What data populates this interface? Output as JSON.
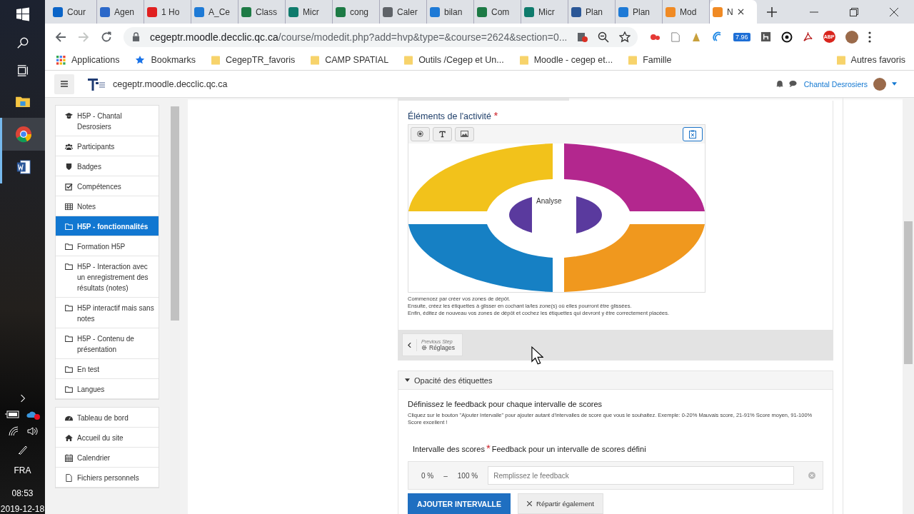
{
  "taskbar": {
    "apps": [
      {
        "kind": "explorer",
        "selected": false,
        "running": false
      },
      {
        "kind": "chrome",
        "selected": true,
        "running": true
      },
      {
        "kind": "word",
        "selected": false,
        "running": true
      }
    ],
    "language": "FRA",
    "time": "08:53",
    "date": "2019-12-18"
  },
  "browser": {
    "tabs": [
      {
        "kind": "outlook",
        "title": "Cour",
        "selected": false
      },
      {
        "kind": "doc",
        "title": "Agen",
        "selected": false
      },
      {
        "kind": "youtube",
        "title": "1 Ho",
        "selected": false
      },
      {
        "kind": "onedrive",
        "title": "A_Ce",
        "selected": false
      },
      {
        "kind": "excel",
        "title": "Class",
        "selected": false
      },
      {
        "kind": "forms",
        "title": "Micr",
        "selected": false
      },
      {
        "kind": "excel",
        "title": "cong",
        "selected": false
      },
      {
        "kind": "globe",
        "title": "Caler",
        "selected": false
      },
      {
        "kind": "onedrive",
        "title": "bilan",
        "selected": false
      },
      {
        "kind": "excel",
        "title": "Com",
        "selected": false
      },
      {
        "kind": "forms",
        "title": "Micr",
        "selected": false
      },
      {
        "kind": "word",
        "title": "Plan",
        "selected": false
      },
      {
        "kind": "onedrive",
        "title": "Plan",
        "selected": false
      },
      {
        "kind": "moodle",
        "title": "Mod",
        "selected": false
      },
      {
        "kind": "moodle",
        "title": "N",
        "selected": true
      }
    ],
    "url_host": "cegeptr.moodle.decclic.qc.ca",
    "url_path": "/course/modedit.php?add=hvp&type=&course=2624&section=0...",
    "extension_badge": "7.96",
    "adblock_label": "ABP",
    "bookmarks": [
      {
        "kind": "apps",
        "label": "Applications"
      },
      {
        "kind": "star",
        "label": "Bookmarks"
      },
      {
        "kind": "folder",
        "label": "CegepTR_favoris"
      },
      {
        "kind": "folder",
        "label": "CAMP SPATIAL"
      },
      {
        "kind": "folder",
        "label": "Outils /Cegep et Un..."
      },
      {
        "kind": "folder",
        "label": "Moodle - cegep et..."
      },
      {
        "kind": "folder",
        "label": "Famille"
      }
    ],
    "other_bookmarks": "Autres favoris"
  },
  "moodle_header": {
    "site": "cegeptr.moodle.decclic.qc.ca",
    "user": "Chantal Desrosiers"
  },
  "sidebar": {
    "groups": [
      [
        {
          "kind": "cap",
          "label": "H5P - Chantal Desrosiers",
          "selected": false
        },
        {
          "kind": "users",
          "label": "Participants",
          "selected": false
        },
        {
          "kind": "shield",
          "label": "Badges",
          "selected": false
        },
        {
          "kind": "check",
          "label": "Compétences",
          "selected": false
        },
        {
          "kind": "table",
          "label": "Notes",
          "selected": false
        },
        {
          "kind": "folder",
          "label": "H5P - fonctionnalités",
          "selected": true
        },
        {
          "kind": "folder",
          "label": "Formation H5P",
          "selected": false
        },
        {
          "kind": "folder",
          "label": "H5P - Interaction avec un enregistrement des résultats (notes)",
          "selected": false
        },
        {
          "kind": "folder",
          "label": "H5P interactif mais sans notes",
          "selected": false
        },
        {
          "kind": "folder",
          "label": "H5P - Contenu de présentation",
          "selected": false
        },
        {
          "kind": "folder",
          "label": "En test",
          "selected": false
        },
        {
          "kind": "folder",
          "label": "Langues",
          "selected": false
        }
      ],
      [
        {
          "kind": "dashboard",
          "label": "Tableau de bord",
          "selected": false
        },
        {
          "kind": "home",
          "label": "Accueil du site",
          "selected": false
        },
        {
          "kind": "calendar",
          "label": "Calendrier",
          "selected": false
        },
        {
          "kind": "file",
          "label": "Fichiers personnels",
          "selected": false
        }
      ]
    ]
  },
  "editor": {
    "title": "Éléments de l'activité",
    "required_mark": "*",
    "drop_label": "Analyse",
    "help": [
      "Commencez par créer vos zones de dépôt.",
      "Ensuite, créez les étiquettes à glisser en cochant la/les zone(s) où elles pourront être glissées.",
      "Enfin, éditez de nouveau vos zones de dépôt et cochez les étiquettes qui devront y être correctement placées."
    ],
    "previous_step": "Previous Step",
    "previous_step_name": "Réglages"
  },
  "feedback": {
    "section_title": "Opacité des étiquettes",
    "heading": "Définissez le feedback pour chaque intervalle de scores",
    "description": "Cliquez sur le bouton \"Ajouter Intervalle\" pour ajouter autant d'intervalles de score que vous le souhaitez. Exemple: 0-20% Mauvais score, 21-91% Score moyen, 91-100% Score excellent !",
    "range_label": "Intervalle des scores",
    "required_mark": "*",
    "feedback_label": "Feedback pour un intervalle de scores défini",
    "rows": [
      {
        "from": "0 %",
        "dash": "–",
        "to": "100 %",
        "placeholder": "Remplissez le feedback"
      }
    ],
    "add_button": "AJOUTER INTERVALLE",
    "distribute_button": "Répartir également"
  }
}
